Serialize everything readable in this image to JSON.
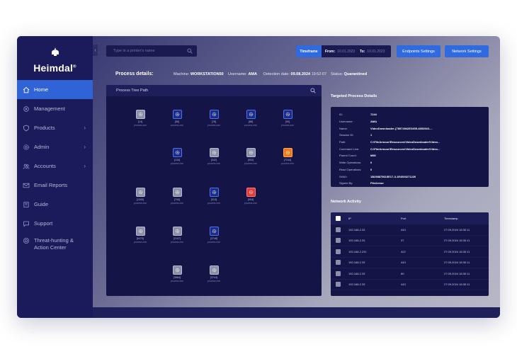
{
  "brand": {
    "name": "Heimdal",
    "trademark": "®"
  },
  "sidebar": {
    "items": [
      {
        "label": "Home",
        "icon": "home-icon",
        "active": true
      },
      {
        "label": "Management",
        "icon": "cog-icon"
      },
      {
        "label": "Products",
        "icon": "shield-icon",
        "chevron": "›"
      },
      {
        "label": "Admin",
        "icon": "gear-icon",
        "chevron": "›"
      },
      {
        "label": "Accounts",
        "icon": "users-icon",
        "chevron": "›"
      },
      {
        "label": "Email Reports",
        "icon": "mail-icon"
      },
      {
        "label": "Guide",
        "icon": "book-icon"
      },
      {
        "label": "Support",
        "icon": "chat-icon"
      },
      {
        "label": "Threat-hunting & Action Center",
        "icon": "target-icon"
      }
    ],
    "collapse_glyph": "‹"
  },
  "topbar": {
    "search_placeholder": "Type in a printer's name",
    "timeframe_label": "Timeframe",
    "from_label": "From:",
    "from_value": "10.01.2023",
    "to_label": "To:",
    "to_value": "10.01.2023",
    "endpoints_btn": "Endpoints Settings",
    "network_btn": "Network Settings"
  },
  "header": {
    "title": "Process details:",
    "machine_label": "Machine:",
    "machine_value": "WORKSTATION50",
    "username_label": "Username:",
    "username_value": "AMA",
    "detection_label": "Detection date:",
    "detection_value": "09.08.2024",
    "detection_time": "19:52:07",
    "status_label": "Status:",
    "status_value": "Quarantined"
  },
  "tree": {
    "title": "Process Tree Path",
    "nodes": [
      {
        "id": "n1",
        "color": "gray",
        "label": "[14]",
        "sub": "process.exe"
      },
      {
        "id": "n2",
        "color": "blue",
        "label": "[56]",
        "sub": "process.exe"
      },
      {
        "id": "n3",
        "color": "blue",
        "label": "[78]",
        "sub": "process.exe"
      },
      {
        "id": "n4",
        "color": "blue",
        "label": "[88]",
        "sub": "process.exe"
      },
      {
        "id": "n5",
        "color": "blue",
        "label": "[90]",
        "sub": "process.exe"
      },
      {
        "id": "n6",
        "color": "blue",
        "label": "[134]",
        "sub": "process.exe"
      },
      {
        "id": "n7",
        "color": "gray",
        "label": "[342]",
        "sub": "process.exe"
      },
      {
        "id": "n8",
        "color": "gray",
        "label": "[902]",
        "sub": "process.exe"
      },
      {
        "id": "n9",
        "color": "orange",
        "label": "[7244]",
        "sub": "process.exe"
      },
      {
        "id": "n10",
        "color": "gray",
        "label": "[1340]",
        "sub": "process.exe"
      },
      {
        "id": "n11",
        "color": "gray",
        "label": "[740]",
        "sub": "process.exe"
      },
      {
        "id": "n12",
        "color": "blue",
        "label": "[913]",
        "sub": "process.exe"
      },
      {
        "id": "n13",
        "color": "red",
        "label": "[904]",
        "sub": "process.exe"
      },
      {
        "id": "n14",
        "color": "gray",
        "label": "[6470]",
        "sub": "process.exe"
      },
      {
        "id": "n15",
        "color": "gray",
        "label": "[2107]",
        "sub": "process.exe"
      },
      {
        "id": "n16",
        "color": "blue",
        "label": "[3748]",
        "sub": "process.exe"
      },
      {
        "id": "n17",
        "color": "gray",
        "label": "[3884]",
        "sub": "process.exe"
      },
      {
        "id": "n18",
        "color": "gray",
        "label": "[3744]",
        "sub": "process.exe"
      }
    ]
  },
  "targeted": {
    "title": "Targeted Process Details",
    "rows": [
      {
        "k": "ID:",
        "v": "7244"
      },
      {
        "k": "Username:",
        "v": "AMA"
      },
      {
        "k": "Name:",
        "v": "VideoDownloader-{78974942E3455-4852943-..."
      },
      {
        "k": "Session ID:",
        "v": "1"
      },
      {
        "k": "Path:",
        "v": "C:\\FileArmour\\Resources\\VideoDownloader\\Video..."
      },
      {
        "k": "Command Line:",
        "v": "C:\\FileArmour\\Resources\\VideoDownloader\\Video..."
      },
      {
        "k": "Parent Count:",
        "v": "M80"
      },
      {
        "k": "Write Operations:",
        "v": "0"
      },
      {
        "k": "Read Operations:",
        "v": "0"
      },
      {
        "k": "SHA1:",
        "v": "1B298875615E17-3-1E4503271220"
      },
      {
        "k": "Signed By:",
        "v": "FileArmor"
      }
    ]
  },
  "network": {
    "title": "Network Activity",
    "columns": [
      "IP",
      "Port",
      "Timestamp"
    ],
    "rows": [
      {
        "ip": "192.168.2.33",
        "port": "443",
        "ts": "27.09.2024 18:30:11"
      },
      {
        "ip": "192.168.2.33",
        "port": "37",
        "ts": "27.09.2024 18:30:11"
      },
      {
        "ip": "192.168.2.231",
        "port": "422",
        "ts": "27.09.2024 18:30:11"
      },
      {
        "ip": "192.168.2.33",
        "port": "443",
        "ts": "27.09.2024 18:30:11"
      },
      {
        "ip": "192.168.2.33",
        "port": "80",
        "ts": "27.09.2024 18:30:11"
      },
      {
        "ip": "192.168.2.33",
        "port": "443",
        "ts": "27.09.2024 18:30:11"
      }
    ]
  },
  "colors": {
    "accent": "#2f6ae0",
    "sidebar": "#1b1b5c",
    "panel": "#141447"
  }
}
